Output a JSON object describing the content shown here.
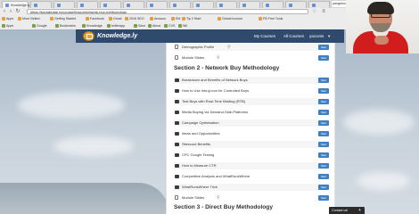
{
  "browser": {
    "url": "https://knowledge.ly/course/lesson/network-buy-methodology",
    "tabs": [
      "Knowledge.ly"
    ],
    "profile_name": "pangebungan",
    "bookmarks": [
      "Apps",
      "Most Visited",
      "Getting Started",
      "Facebook",
      "Gmail",
      "2016 SEO",
      "Amazon",
      "EM",
      "Tip 2 Start",
      "Global Income",
      "FB Free Tools"
    ],
    "extensions": [
      "Apps",
      "Google",
      "Bookmarks",
      "Knowledge",
      "bufferapp",
      "Save",
      "Alexa",
      "CVS",
      "Wk"
    ]
  },
  "site": {
    "logo_text": "Knowledge.ly",
    "nav": {
      "my_courses": "My Courses",
      "all_courses": "All Courses",
      "user": "yaccess"
    }
  },
  "lessons_top": [
    {
      "title": "Demographic Profile",
      "icon": "document-icon",
      "attachment": true
    },
    {
      "title": "Module Slides",
      "icon": "document-icon",
      "attachment": true
    }
  ],
  "section2": {
    "title": "Section 2 - Network Buy Methodology",
    "lessons": [
      {
        "title": "Breakdown and Benefits of Network Buys",
        "icon": "video-icon",
        "attachment": false
      },
      {
        "title": "How to Use Inbuy.com for Controlled Buys",
        "icon": "video-icon",
        "attachment": false
      },
      {
        "title": "Test Buys with Real-Time Bidding (RTB)",
        "icon": "video-icon",
        "attachment": false
      },
      {
        "title": "Media Buying via Demand-Side-Platforms",
        "icon": "video-icon",
        "attachment": false
      },
      {
        "title": "Campaign Optimization",
        "icon": "video-icon",
        "attachment": false
      },
      {
        "title": "Ideas and Opportunities",
        "icon": "video-icon",
        "attachment": false
      },
      {
        "title": "Sitescout Benefits",
        "icon": "video-icon",
        "attachment": false
      },
      {
        "title": "CPC Google Testing",
        "icon": "video-icon",
        "attachment": false
      },
      {
        "title": "How to Measure CTR",
        "icon": "video-icon",
        "attachment": false
      },
      {
        "title": "Competitive Analysis and WhatRunsWhere",
        "icon": "video-icon",
        "attachment": false
      },
      {
        "title": "WhatRunsWhere Trick",
        "icon": "video-icon",
        "attachment": false
      },
      {
        "title": "Module Slides",
        "icon": "document-icon",
        "attachment": true
      }
    ]
  },
  "section3": {
    "title": "Section 3 - Direct Buy Methodology"
  },
  "start_label": "Start",
  "contact_label": "Contact us!",
  "contact_plus": "+"
}
